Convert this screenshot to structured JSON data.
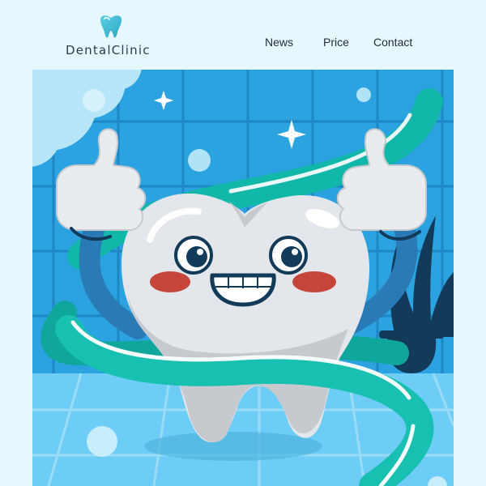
{
  "brand": {
    "name": "DentalClinic",
    "logo_icon": "tooth-icon",
    "accent_color": "#3fc2c9"
  },
  "nav": {
    "items": [
      {
        "label": "News"
      },
      {
        "label": "Price"
      },
      {
        "label": "Contact"
      }
    ]
  },
  "hero": {
    "illustration": "tooth-mascot-thumbs-up-illustration",
    "colors": {
      "wall": "#2ba3e0",
      "tile_lines": "#1f86c4",
      "floor": "#6ecdf6",
      "ribbon": "#17c0b0",
      "tooth": "#e3e6ea",
      "blush": "#c6453b"
    }
  }
}
